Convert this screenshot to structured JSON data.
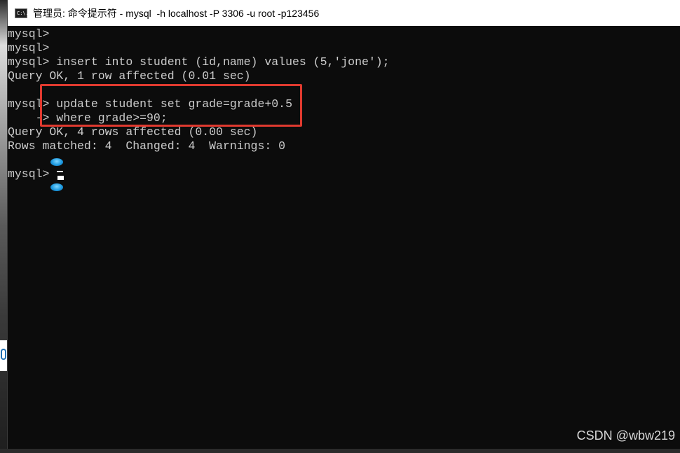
{
  "window": {
    "title": "管理员: 命令提示符 - mysql  -h localhost -P 3306 -u root -p123456",
    "icon": "cmd-icon",
    "icon_text": "C:\\."
  },
  "console": {
    "lines": [
      "mysql>",
      "mysql>",
      "mysql> insert into student (id,name) values (5,'jone');",
      "Query OK, 1 row affected (0.01 sec)",
      "",
      "mysql> update student set grade=grade+0.5",
      "    -> where grade>=90;",
      "Query OK, 4 rows affected (0.00 sec)",
      "Rows matched: 4  Changed: 4  Warnings: 0",
      "",
      "mysql>"
    ],
    "highlight_color": "#e03a2f",
    "text_color": "#cccccc",
    "background": "#0c0c0c"
  },
  "watermark": {
    "text": "CSDN @wbw219"
  }
}
